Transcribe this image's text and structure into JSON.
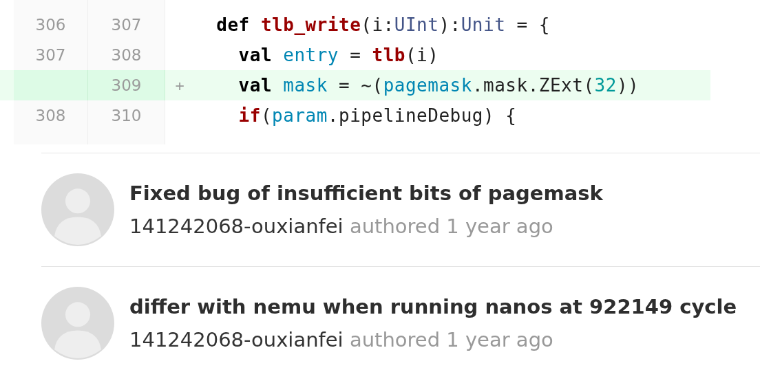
{
  "diff": {
    "lines": [
      {
        "old": "306",
        "new": "307",
        "added": false,
        "tokens": [
          {
            "kind": "keyword",
            "text": "  def "
          },
          {
            "kind": "function",
            "text": "tlb_write"
          },
          {
            "kind": "plain",
            "text": "(i:"
          },
          {
            "kind": "type",
            "text": "UInt"
          },
          {
            "kind": "plain",
            "text": "):"
          },
          {
            "kind": "type",
            "text": "Unit"
          },
          {
            "kind": "plain",
            "text": " = {"
          }
        ]
      },
      {
        "old": "307",
        "new": "308",
        "added": false,
        "tokens": [
          {
            "kind": "keyword",
            "text": "    val "
          },
          {
            "kind": "name",
            "text": "entry"
          },
          {
            "kind": "plain",
            "text": " = "
          },
          {
            "kind": "function",
            "text": "tlb"
          },
          {
            "kind": "plain",
            "text": "(i)"
          }
        ]
      },
      {
        "new": "309",
        "marker": "+",
        "added": true,
        "tokens": [
          {
            "kind": "keyword",
            "text": "    val "
          },
          {
            "kind": "name",
            "text": "mask"
          },
          {
            "kind": "plain",
            "text": " = ~("
          },
          {
            "kind": "name",
            "text": "pagemask"
          },
          {
            "kind": "plain",
            "text": ".mask.ZExt("
          },
          {
            "kind": "number",
            "text": "32"
          },
          {
            "kind": "plain",
            "text": "))"
          }
        ]
      },
      {
        "old": "308",
        "new": "310",
        "added": false,
        "tokens": [
          {
            "kind": "control",
            "text": "    if"
          },
          {
            "kind": "plain",
            "text": "("
          },
          {
            "kind": "name",
            "text": "param"
          },
          {
            "kind": "plain",
            "text": ".pipelineDebug) {"
          }
        ]
      }
    ]
  },
  "commits": [
    {
      "title": "Fixed bug of insufficient bits of pagemask",
      "author": "141242068-ouxianfei",
      "action": "authored 1 year ago"
    },
    {
      "title": "differ with nemu when running nanos at 922149 cycle",
      "author": "141242068-ouxianfei",
      "action": "authored 1 year ago"
    }
  ]
}
